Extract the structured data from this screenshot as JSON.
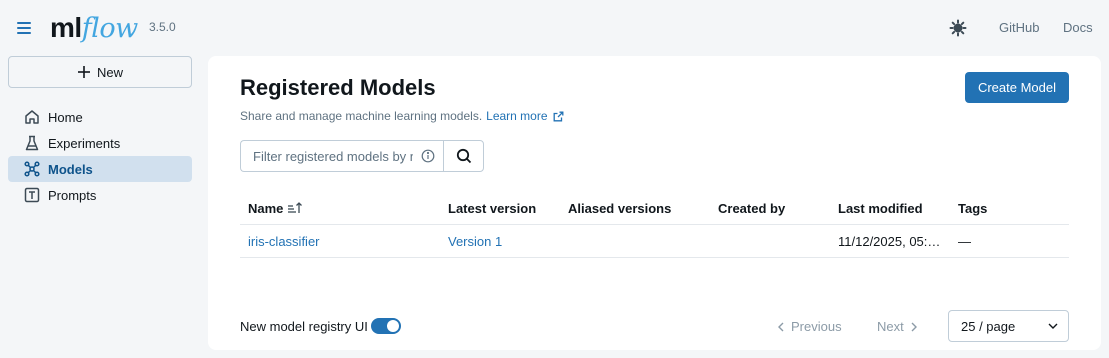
{
  "app": {
    "version": "3.5.0",
    "logo_ml": "ml",
    "logo_flow": "flow",
    "accent_color": "#2272b4"
  },
  "topbar": {
    "github_label": "GitHub",
    "docs_label": "Docs",
    "theme_icon": "gear-icon"
  },
  "sidebar": {
    "new_label": "New",
    "items": [
      {
        "label": "Home",
        "icon": "home-icon",
        "active": false
      },
      {
        "label": "Experiments",
        "icon": "beaker-icon",
        "active": false
      },
      {
        "label": "Models",
        "icon": "models-icon",
        "active": true
      },
      {
        "label": "Prompts",
        "icon": "prompt-icon",
        "active": false
      }
    ]
  },
  "main": {
    "title": "Registered Models",
    "subtitle": "Share and manage machine learning models.",
    "learn_more": "Learn more",
    "create_button": "Create Model",
    "search": {
      "placeholder": "Filter registered models by name or tags",
      "value": ""
    },
    "table": {
      "columns": [
        "Name",
        "Latest version",
        "Aliased versions",
        "Created by",
        "Last modified",
        "Tags"
      ],
      "rows": [
        {
          "name": "iris-classifier",
          "latest_version": "Version 1",
          "aliased_versions": "",
          "created_by": "",
          "last_modified": "11/12/2025, 05:…",
          "tags": "—"
        }
      ]
    },
    "footer": {
      "toggle_label": "New model registry UI",
      "toggle_on": true,
      "previous_label": "Previous",
      "next_label": "Next",
      "page_size": "25 / page"
    }
  }
}
